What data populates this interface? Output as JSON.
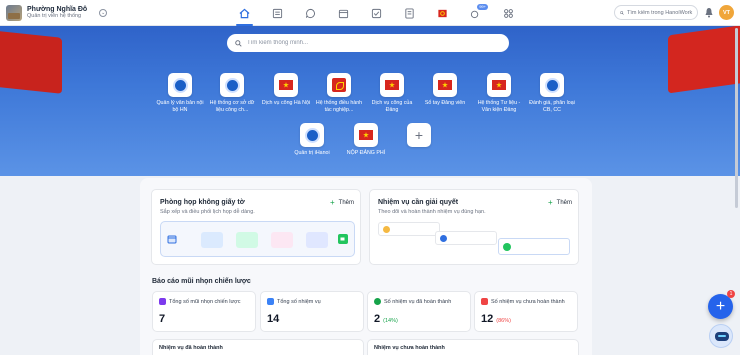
{
  "header": {
    "org_name": "Phường Nghĩa Đô",
    "org_role": "Quản trị viên hệ thống",
    "search_placeholder": "Tìm kiếm trong HanoiWork",
    "avatar_initials": "VT",
    "nav_badge": "99+",
    "nav_items": [
      "home-icon",
      "news-icon",
      "chat-icon",
      "calendar-icon",
      "task-icon",
      "document-icon",
      "party-icon",
      "analytics-icon",
      "apps-grid-icon"
    ]
  },
  "hero": {
    "search_placeholder": "Tìm kiếm thông minh...",
    "apps": [
      {
        "label": "Quản lý văn bản nội bộ HN",
        "icon": "hanoi-seal-icon"
      },
      {
        "label": "Hệ thống cơ sở dữ liệu công ch...",
        "icon": "hanoi-seal-icon"
      },
      {
        "label": "Dịch vụ công Hà Nội",
        "icon": "vn-flag-icon"
      },
      {
        "label": "Hệ thống điều hành tác nghiệp...",
        "icon": "party-flag-icon"
      },
      {
        "label": "Dịch vụ công của Đảng",
        "icon": "vn-flag-icon"
      },
      {
        "label": "Sổ tay Đảng viên",
        "icon": "vn-flag-icon"
      },
      {
        "label": "Hệ thống Tư liệu - Văn kiện Đảng",
        "icon": "vn-flag-icon"
      },
      {
        "label": "Đánh giá, phân loại CB, CC",
        "icon": "hanoi-seal-icon"
      },
      {
        "label": "Quản trị iHanoi",
        "icon": "ihanoi-icon"
      },
      {
        "label": "NỘP ĐẢNG PHÍ",
        "icon": "vn-flag-icon"
      },
      {
        "label": "",
        "icon": "add-app-icon"
      }
    ]
  },
  "meetings": {
    "title": "Phòng họp không giấy tờ",
    "subtitle": "Sắp xếp và điều phối lịch họp dễ dàng.",
    "add_label": "Thêm"
  },
  "tasks": {
    "title": "Nhiệm vụ cần giải quyết",
    "subtitle": "Theo dõi và hoàn thành nhiệm vụ đúng hạn.",
    "add_label": "Thêm"
  },
  "report": {
    "title": "Báo cáo mũi nhọn chiến lược",
    "stats": [
      {
        "label": "Tổng số mũi nhọn chiến lược",
        "value": "7",
        "pct": "",
        "color": "#7c3aed"
      },
      {
        "label": "Tổng số nhiệm vụ",
        "value": "14",
        "pct": "",
        "color": "#3b82f6"
      },
      {
        "label": "Số nhiệm vụ đã hoàn thành",
        "value": "2",
        "pct": "(14%)",
        "color": "#16a34a"
      },
      {
        "label": "Số nhiệm vụ chưa hoàn thành",
        "value": "12",
        "pct": "(86%)",
        "color": "#ef4444"
      }
    ],
    "completed_title": "Nhiệm vụ đã hoàn thành",
    "pending_title": "Nhiệm vụ chưa hoàn thành"
  },
  "fab": {
    "label": "+",
    "badge": "1"
  }
}
